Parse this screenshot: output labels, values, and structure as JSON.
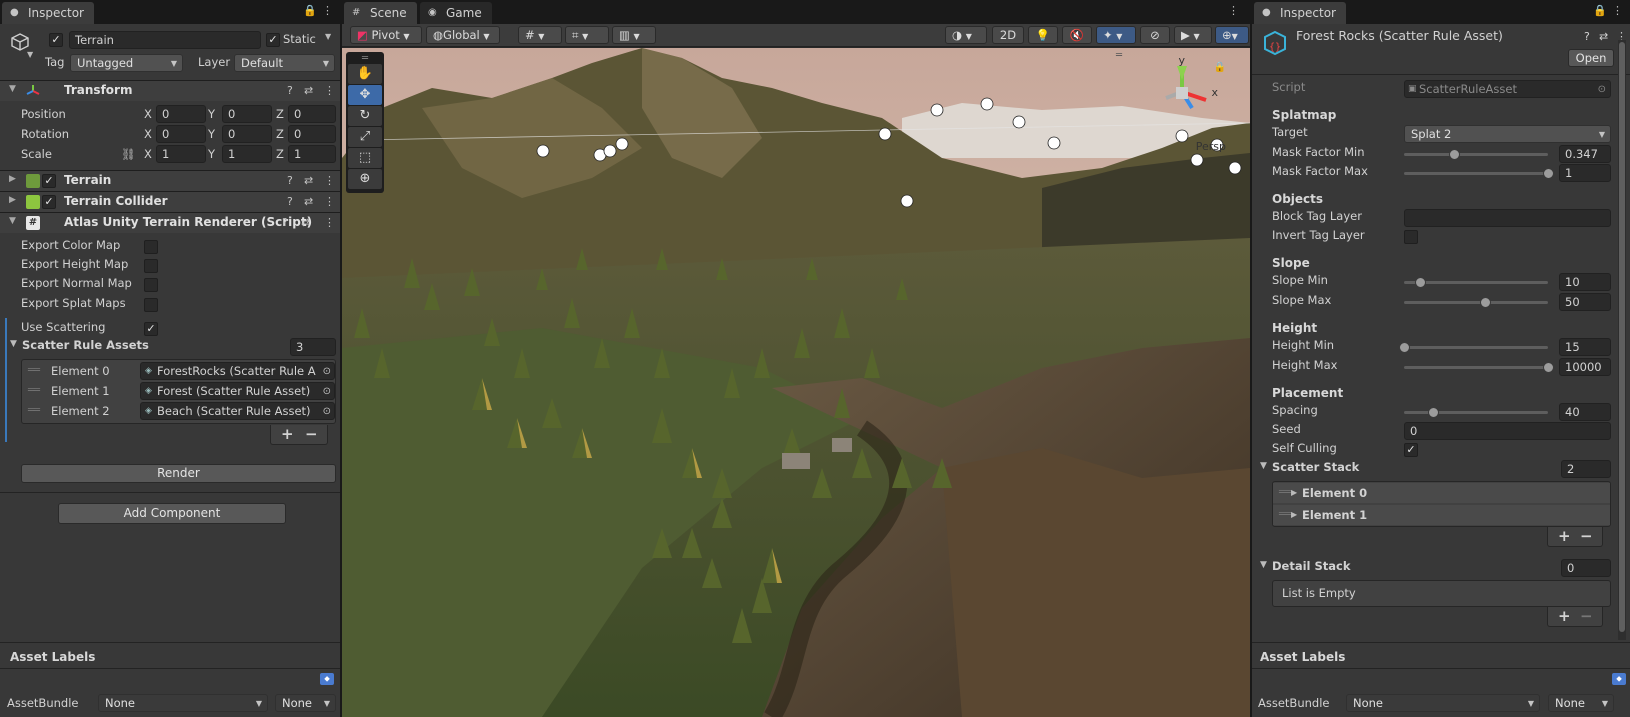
{
  "left_inspector": {
    "tab_title": "Inspector",
    "object_name": "Terrain",
    "static_label": "Static",
    "tag_label": "Tag",
    "tag_value": "Untagged",
    "layer_label": "Layer",
    "layer_value": "Default",
    "transform": {
      "title": "Transform",
      "position_label": "Position",
      "rotation_label": "Rotation",
      "scale_label": "Scale",
      "axis_x": "X",
      "axis_y": "Y",
      "axis_z": "Z",
      "position": [
        "0",
        "0",
        "0"
      ],
      "rotation": [
        "0",
        "0",
        "0"
      ],
      "scale": [
        "1",
        "1",
        "1"
      ]
    },
    "components": {
      "terrain": "Terrain",
      "terrain_collider": "Terrain Collider",
      "renderer_script": "Atlas Unity Terrain Renderer (Script)"
    },
    "fields": {
      "export_color_map": "Export Color Map",
      "export_height_map": "Export Height Map",
      "export_normal_map": "Export Normal Map",
      "export_splat_maps": "Export Splat Maps",
      "use_scattering": "Use Scattering",
      "use_scattering_check": "✓",
      "scatter_rule_assets": "Scatter Rule Assets",
      "scatter_rule_count": "3"
    },
    "elements": [
      {
        "label": "Element 0",
        "value": "ForestRocks (Scatter Rule A"
      },
      {
        "label": "Element 1",
        "value": "Forest (Scatter Rule Asset)"
      },
      {
        "label": "Element 2",
        "value": "Beach (Scatter Rule Asset)"
      }
    ],
    "plus": "+",
    "minus": "−",
    "render_button": "Render",
    "add_component_button": "Add Component",
    "asset_labels": "Asset Labels",
    "asset_bundle_label": "AssetBundle",
    "asset_bundle_value": "None",
    "asset_bundle_variant": "None"
  },
  "scene": {
    "tab_scene": "Scene",
    "tab_game": "Game",
    "pivot": "Pivot",
    "global": "Global",
    "mode_2d": "2D",
    "persp_label": "Persp",
    "gizmo_y": "y",
    "gizmo_x": "x"
  },
  "right_inspector": {
    "tab_title": "Inspector",
    "asset_title": "Forest Rocks (Scatter Rule Asset)",
    "open_button": "Open",
    "script_label": "Script",
    "script_value": "ScatterRuleAsset",
    "splatmap_section": "Splatmap",
    "target_label": "Target",
    "target_value": "Splat 2",
    "mask_factor_min_label": "Mask Factor Min",
    "mask_factor_min_value": "0.347",
    "mask_factor_max_label": "Mask Factor Max",
    "mask_factor_max_value": "1",
    "objects_section": "Objects",
    "block_tag_layer_label": "Block Tag Layer",
    "invert_tag_layer_label": "Invert Tag Layer",
    "slope_section": "Slope",
    "slope_min_label": "Slope Min",
    "slope_min_value": "10",
    "slope_max_label": "Slope Max",
    "slope_max_value": "50",
    "height_section": "Height",
    "height_min_label": "Height Min",
    "height_min_value": "15",
    "height_max_label": "Height Max",
    "height_max_value": "10000",
    "placement_section": "Placement",
    "spacing_label": "Spacing",
    "spacing_value": "40",
    "seed_label": "Seed",
    "seed_value": "0",
    "self_culling_label": "Self Culling",
    "self_culling_check": "✓",
    "scatter_stack_label": "Scatter Stack",
    "scatter_stack_count": "2",
    "scatter_elements": [
      "Element 0",
      "Element 1"
    ],
    "detail_stack_label": "Detail Stack",
    "detail_stack_count": "0",
    "list_empty": "List is Empty",
    "plus": "+",
    "minus": "−",
    "asset_labels": "Asset Labels",
    "asset_bundle_label": "AssetBundle",
    "asset_bundle_value": "None",
    "asset_bundle_variant": "None"
  },
  "slider_levels": {
    "mask_factor_min": 0.347,
    "mask_factor_max": 1.0,
    "slope_min": 0.11,
    "slope_max": 0.56,
    "height_min": 0.0,
    "height_max": 1.0,
    "spacing": 0.2
  }
}
